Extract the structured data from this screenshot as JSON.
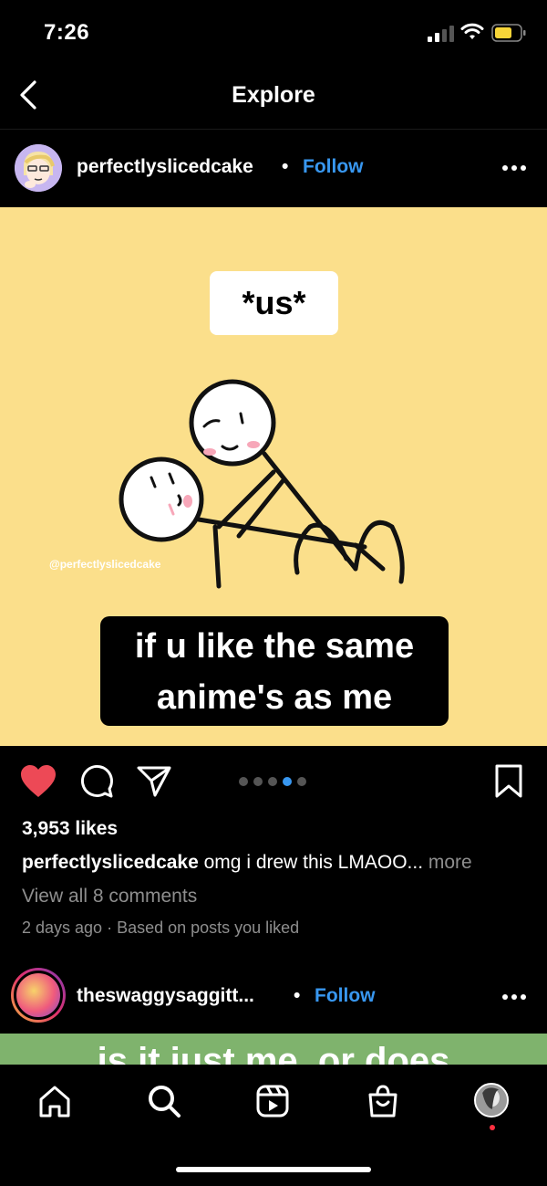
{
  "status_bar": {
    "time": "7:26",
    "icons": [
      "cellular-signal-icon",
      "wifi-icon",
      "battery-icon"
    ],
    "battery_color": "#f7d538"
  },
  "nav": {
    "title": "Explore",
    "back_icon": "chevron-left-icon"
  },
  "post": {
    "username": "perfectlyslicedcake",
    "separator": "•",
    "follow_label": "Follow",
    "image": {
      "top_label": "*us*",
      "watermark": "@perfectlyslicedcake",
      "caption_line1": "if u like the same",
      "caption_line2": "anime's as me",
      "background_color": "#fbdf8b"
    },
    "actions": {
      "liked": true,
      "icons": [
        "heart-icon",
        "comment-icon",
        "share-icon",
        "bookmark-icon"
      ],
      "carousel_count": 5,
      "carousel_active_index": 3
    },
    "likes": "3,953 likes",
    "caption_username": "perfectlyslicedcake",
    "caption_text": " omg i drew this LMAOO...",
    "caption_more": " more",
    "view_comments": "View all 8 comments",
    "meta": "2 days ago · Based on posts you liked"
  },
  "next_post": {
    "username": "theswaggysaggitt...",
    "separator": "•",
    "follow_label": "Follow",
    "image_text": "is it just me, or does"
  },
  "colors": {
    "accent_blue": "#3897f0",
    "like_red": "#ed4956",
    "muted_gray": "#8e8e8e"
  },
  "tab_bar": {
    "tabs": [
      "home-icon",
      "search-icon",
      "reels-icon",
      "shop-icon",
      "profile-avatar"
    ]
  }
}
